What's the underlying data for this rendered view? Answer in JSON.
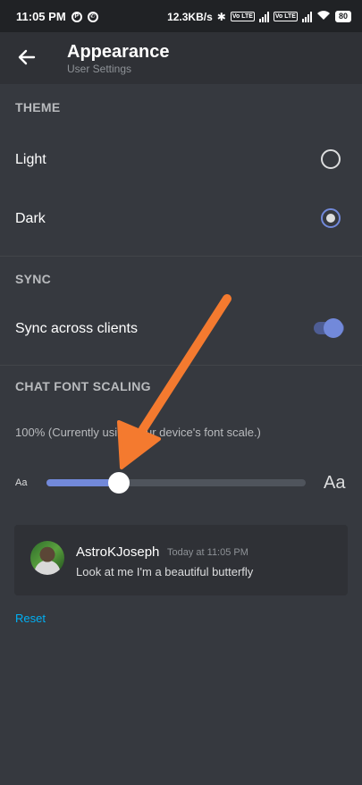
{
  "status_bar": {
    "time": "11:05 PM",
    "left_icons": [
      "pinterest-icon",
      "whatsapp-icon"
    ],
    "net_speed": "12.3KB/s",
    "sim_tag": "Vo LTE",
    "battery": "80"
  },
  "header": {
    "back_icon": "arrow-left-icon",
    "title": "Appearance",
    "subtitle": "User Settings"
  },
  "theme": {
    "heading": "THEME",
    "options": [
      {
        "label": "Light",
        "selected": false
      },
      {
        "label": "Dark",
        "selected": true
      }
    ]
  },
  "sync": {
    "heading": "SYNC",
    "label": "Sync across clients",
    "enabled": true
  },
  "font_scaling": {
    "heading": "CHAT FONT SCALING",
    "description": "100% (Currently using your device's font scale.)",
    "small_label": "Aa",
    "large_label": "Aa",
    "slider_value": 0.28
  },
  "preview": {
    "username": "AstroKJoseph",
    "timestamp": "Today at 11:05 PM",
    "message": "Look at me I'm a beautiful butterfly"
  },
  "reset_label": "Reset",
  "colors": {
    "background": "#36393f",
    "accent": "#7289da",
    "link": "#00b0f4",
    "annotation_arrow": "#f47a2f"
  }
}
